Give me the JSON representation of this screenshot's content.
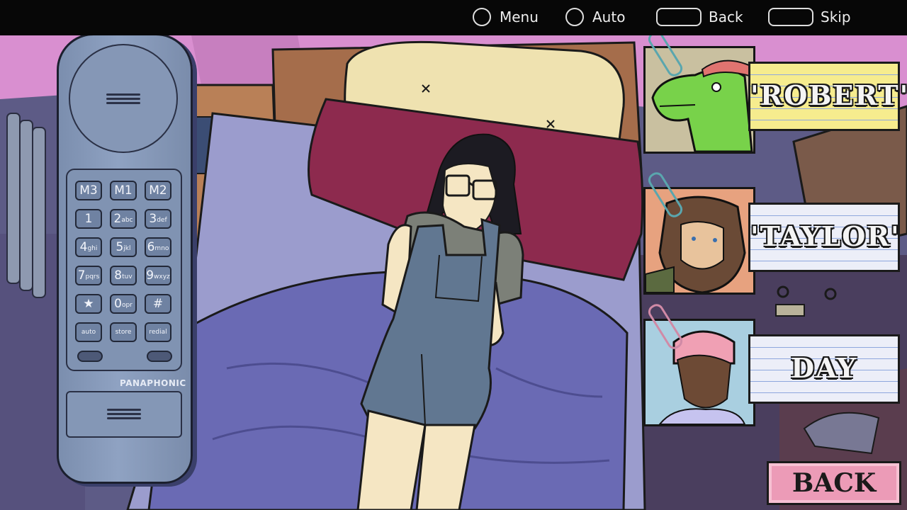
{
  "topbar": {
    "menu_label": "Menu",
    "auto_label": "Auto",
    "back_label": "Back",
    "skip_label": "Skip"
  },
  "phone": {
    "brand": "PANAPHONIC",
    "keys": {
      "m3": "M3",
      "m1": "M1",
      "m2": "M2",
      "k1": "1",
      "k2": "2",
      "k2_sub": "abc",
      "k3": "3",
      "k3_sub": "def",
      "k4": "4",
      "k4_sub": "ghi",
      "k5": "5",
      "k5_sub": "jkl",
      "k6": "6",
      "k6_sub": "mno",
      "k7": "7",
      "k7_sub": "pqrs",
      "k8": "8",
      "k8_sub": "tuv",
      "k9": "9",
      "k9_sub": "wxyz",
      "star": "★",
      "k0": "0",
      "k0_sub": "opr",
      "hash": "#",
      "auto": "auto",
      "store": "store",
      "redial": "redial"
    }
  },
  "contacts": [
    {
      "name": "'ROBERT'",
      "paper_color": "#f6ec8e",
      "clip_color": "#5aa6ae",
      "icon": "dinosaur-portrait-icon"
    },
    {
      "name": "'TAYLOR'",
      "paper_color": "#eceef8",
      "clip_color": "#5aa6ae",
      "icon": "werewolf-portrait-icon"
    },
    {
      "name": "DAY",
      "paper_color": "#eceef8",
      "clip_color": "#d08aa6",
      "icon": "woman-portrait-icon"
    }
  ],
  "back_button": {
    "label": "BACK",
    "color": "#ec9bb7"
  },
  "colors": {
    "wall": "#d98fd0",
    "blanket": "#6a6ab4",
    "pillow": "#8d2a4e",
    "skin": "#f5e6c3",
    "overalls": "#617791"
  }
}
